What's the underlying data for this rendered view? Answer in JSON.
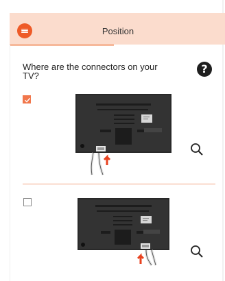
{
  "header": {
    "title": "Position",
    "menu_icon": "hamburger-icon",
    "accent": "#ee5b28",
    "background": "#fbdccd"
  },
  "question": {
    "text": "Where are the connectors on your TV?",
    "help_symbol": "?"
  },
  "options": [
    {
      "name": "connectors-bottom-left",
      "checked": true,
      "zoom_icon": "magnifier-icon"
    },
    {
      "name": "connectors-bottom-right",
      "checked": false,
      "zoom_icon": "magnifier-icon"
    }
  ],
  "colors": {
    "divider": "#f2a37f",
    "checked": "#f1774c",
    "arrow": "#e8421f"
  }
}
